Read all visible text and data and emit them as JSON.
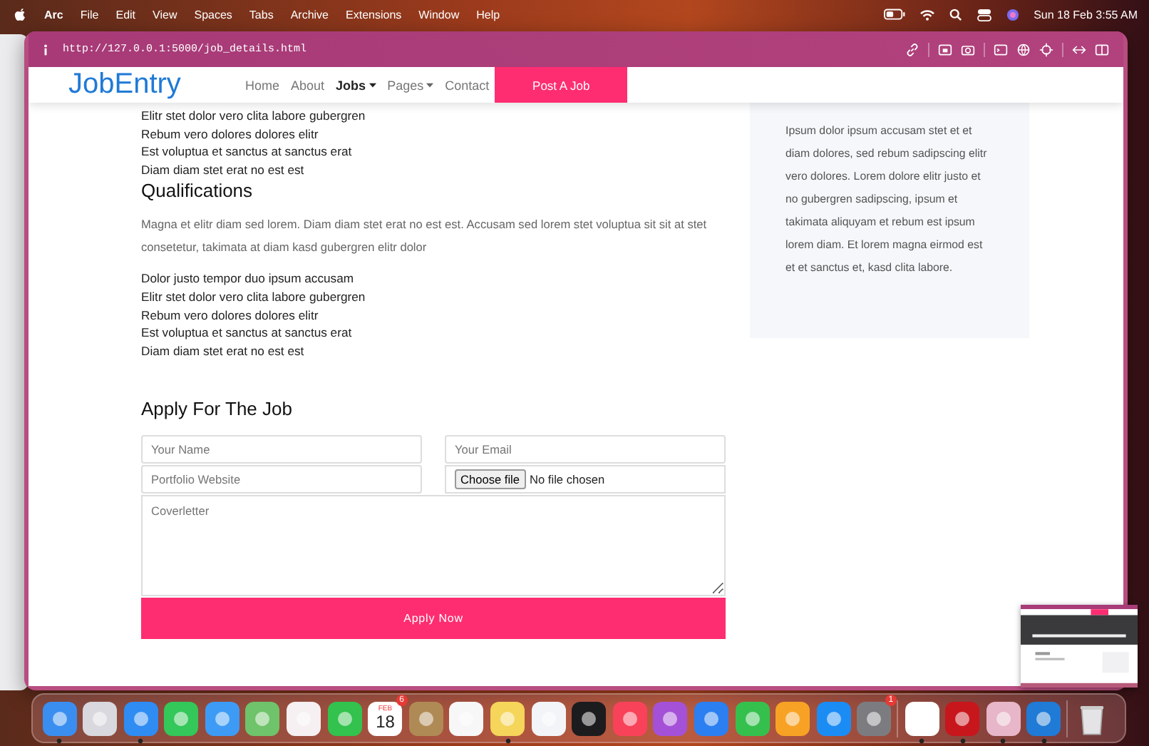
{
  "menubar": {
    "app": "Arc",
    "menus": [
      "File",
      "Edit",
      "View",
      "Spaces",
      "Tabs",
      "Archive",
      "Extensions",
      "Window",
      "Help"
    ],
    "clock": "Sun 18 Feb  3:55 AM"
  },
  "browser": {
    "url": "http://127.0.0.1:5000/job_details.html"
  },
  "nav": {
    "logo": "JobEntry",
    "links": [
      {
        "label": "Home",
        "selected": false,
        "dropdown": false
      },
      {
        "label": "About",
        "selected": false,
        "dropdown": false
      },
      {
        "label": "Jobs",
        "selected": true,
        "dropdown": true
      },
      {
        "label": "Pages",
        "selected": false,
        "dropdown": true
      },
      {
        "label": "Contact",
        "selected": false,
        "dropdown": false
      }
    ],
    "cta": "Post A Job"
  },
  "content": {
    "list_1": [
      "Elitr stet dolor vero clita labore gubergren",
      "Rebum vero dolores dolores elitr",
      "Est voluptua et sanctus at sanctus erat",
      "Diam diam stet erat no est est"
    ],
    "heading": "Qualifications",
    "paragraph": "Magna et elitr diam sed lorem. Diam diam stet erat no est est. Accusam sed lorem stet voluptua sit sit at stet consetetur, takimata at diam kasd gubergren elitr dolor",
    "list_2": [
      "Dolor justo tempor duo ipsum accusam",
      "Elitr stet dolor vero clita labore gubergren",
      "Rebum vero dolores dolores elitr",
      "Est voluptua et sanctus at sanctus erat",
      "Diam diam stet erat no est est"
    ],
    "apply_heading": "Apply For The Job",
    "form": {
      "name": {
        "placeholder": "Your Name"
      },
      "email": {
        "placeholder": "Your Email"
      },
      "portfolio": {
        "placeholder": "Portfolio Website"
      },
      "file_button": "Choose file",
      "file_status": "No file chosen",
      "coverletter": {
        "placeholder": "Coverletter"
      },
      "submit": "Apply Now"
    }
  },
  "sidebar": {
    "text": "Ipsum dolor ipsum accusam stet et et diam dolores, sed rebum sadipscing elitr vero dolores. Lorem dolore elitr justo et no gubergren sadipscing, ipsum et takimata aliquyam et rebum est ipsum lorem diam. Et lorem magna eirmod est et et sanctus et, kasd clita labore."
  },
  "dock": {
    "apps": [
      {
        "kind": "app",
        "color": "#3a8ef0",
        "running": true
      },
      {
        "kind": "app",
        "color": "#d8d8de",
        "running": false
      },
      {
        "kind": "app",
        "color": "#2f8cf3",
        "running": true
      },
      {
        "kind": "app",
        "color": "#34c759",
        "running": false
      },
      {
        "kind": "app",
        "color": "#3d9bf5",
        "running": false
      },
      {
        "kind": "app",
        "color": "#6fc36a",
        "running": false
      },
      {
        "kind": "app",
        "color": "#f6f0f2",
        "running": false
      },
      {
        "kind": "app",
        "color": "#32c24d",
        "running": false
      },
      {
        "kind": "calendar",
        "color": "#ffffff",
        "running": false,
        "month": "FEB",
        "day": "18",
        "badge": "6"
      },
      {
        "kind": "app",
        "color": "#b08a55",
        "running": false
      },
      {
        "kind": "app",
        "color": "#f7f7f7",
        "running": false
      },
      {
        "kind": "app",
        "color": "#f5d55a",
        "running": true
      },
      {
        "kind": "app",
        "color": "#f2f4f8",
        "running": false
      },
      {
        "kind": "app",
        "color": "#1c1c1e",
        "running": false
      },
      {
        "kind": "app",
        "color": "#f8425a",
        "running": false
      },
      {
        "kind": "app",
        "color": "#a451d8",
        "running": false
      },
      {
        "kind": "app",
        "color": "#2b7ff0",
        "running": false
      },
      {
        "kind": "app",
        "color": "#35c04e",
        "running": false
      },
      {
        "kind": "app",
        "color": "#f8a225",
        "running": false
      },
      {
        "kind": "app",
        "color": "#1c8cf5",
        "running": false
      },
      {
        "kind": "app",
        "color": "#7c7c80",
        "running": false,
        "badge": "1"
      },
      {
        "kind": "separator"
      },
      {
        "kind": "app",
        "color": "#ffffff",
        "running": true
      },
      {
        "kind": "app",
        "color": "#c8161d",
        "running": true
      },
      {
        "kind": "app",
        "color": "#e7b6c8",
        "running": true
      },
      {
        "kind": "app",
        "color": "#1f7bd6",
        "running": true
      },
      {
        "kind": "separator"
      },
      {
        "kind": "trash",
        "color": "#e4e4e6",
        "running": false
      }
    ]
  }
}
